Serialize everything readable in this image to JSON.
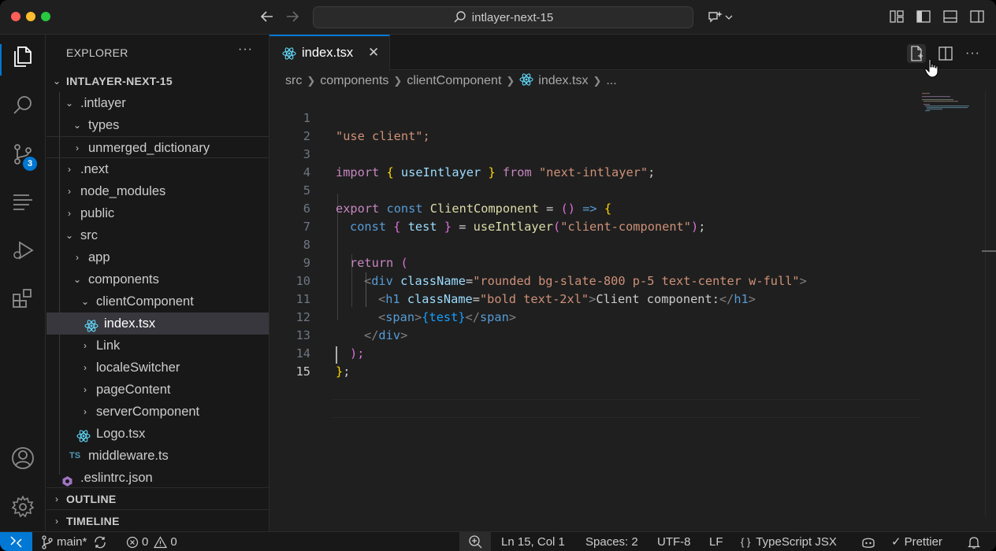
{
  "titlebar": {
    "search_text": "intlayer-next-15"
  },
  "activity": {
    "scm_badge": "3"
  },
  "sidebar": {
    "header": "EXPLORER",
    "more": "···",
    "project": "INTLAYER-NEXT-15",
    "items": [
      {
        "label": ".intlayer"
      },
      {
        "label": "types"
      },
      {
        "label": "unmerged_dictionary"
      },
      {
        "label": ".next"
      },
      {
        "label": "node_modules"
      },
      {
        "label": "public"
      },
      {
        "label": "src"
      },
      {
        "label": "app"
      },
      {
        "label": "components"
      },
      {
        "label": "clientComponent"
      },
      {
        "label": "index.tsx"
      },
      {
        "label": "Link"
      },
      {
        "label": "localeSwitcher"
      },
      {
        "label": "pageContent"
      },
      {
        "label": "serverComponent"
      },
      {
        "label": "Logo.tsx"
      },
      {
        "label": "middleware.ts"
      },
      {
        "label": ".eslintrc.json"
      }
    ],
    "ts_badge": "TS",
    "outline": "OUTLINE",
    "timeline": "TIMELINE"
  },
  "editor": {
    "tab_label": "index.tsx",
    "breadcrumb": [
      "src",
      "components",
      "clientComponent",
      "index.tsx",
      "..."
    ],
    "line_numbers": [
      "1",
      "2",
      "3",
      "4",
      "5",
      "6",
      "7",
      "8",
      "9",
      "10",
      "11",
      "12",
      "13",
      "14",
      "15"
    ],
    "code": {
      "l1": "\"use client\";",
      "l3_import": "import",
      "l3_open": "{",
      "l3_name": "useIntlayer",
      "l3_close": "}",
      "l3_from": "from",
      "l3_str": "\"next-intlayer\"",
      "l3_semi": ";",
      "l5_export": "export",
      "l5_const": "const",
      "l5_name": "ClientComponent",
      "l5_eq": "=",
      "l5_paren": "()",
      "l5_arrow": "=>",
      "l5_brace": "{",
      "l6_const": "const",
      "l6_open": "{",
      "l6_var": "test",
      "l6_close": "}",
      "l6_eq": "=",
      "l6_fn": "useIntlayer",
      "l6_po": "(",
      "l6_str": "\"client-component\"",
      "l6_pc": ")",
      "l6_semi": ";",
      "l8_return": "return",
      "l8_paren": "(",
      "l9_lt": "<",
      "l9_tag": "div",
      "l9_attr": "className",
      "l9_eq": "=",
      "l9_str": "\"rounded bg-slate-800 p-5 text-center w-full\"",
      "l9_gt": ">",
      "l10_lt": "<",
      "l10_tag": "h1",
      "l10_attr": "className",
      "l10_eq": "=",
      "l10_str": "\"bold text-2xl\"",
      "l10_gt": ">",
      "l10_text": "Client component:",
      "l10_close_lt": "</",
      "l10_close_tag": "h1",
      "l10_close_gt": ">",
      "l11_lt": "<",
      "l11_tag": "span",
      "l11_gt": ">",
      "l11_expr": "{test}",
      "l11_close_lt": "</",
      "l11_close_tag": "span",
      "l11_close_gt": ">",
      "l12_lt": "</",
      "l12_tag": "div",
      "l12_gt": ">",
      "l13": ");",
      "l14_brace": "}",
      "l14_semi": ";"
    }
  },
  "statusbar": {
    "branch": "main*",
    "errors": "0",
    "warnings": "0",
    "position": "Ln 15, Col 1",
    "spaces": "Spaces: 2",
    "encoding": "UTF-8",
    "eol": "LF",
    "language_braces": "{ }",
    "language": "TypeScript JSX",
    "prettier": "Prettier"
  },
  "colors": {
    "accent": "#0078d4",
    "background": "#1f1f1f",
    "sidebar": "#181818"
  }
}
